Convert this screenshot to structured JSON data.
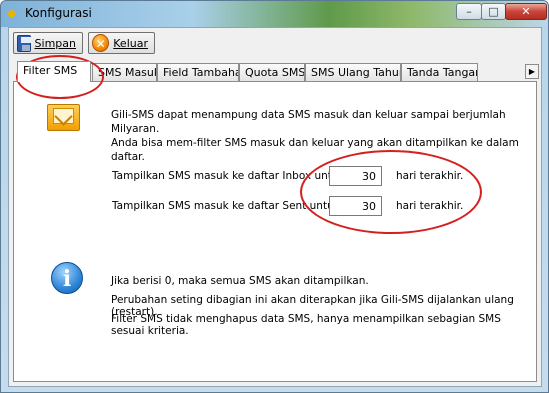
{
  "window": {
    "title": "Konfigurasi",
    "min_glyph": "–",
    "max_glyph": "□",
    "close_glyph": "✕"
  },
  "toolbar": {
    "save_label": "Simpan",
    "exit_label": "Keluar"
  },
  "tabs": [
    {
      "label": "Filter SMS",
      "active": true
    },
    {
      "label": "SMS Masuk"
    },
    {
      "label": "Field Tambahan"
    },
    {
      "label": "Quota SMS"
    },
    {
      "label": "SMS Ulang Tahun"
    },
    {
      "label": "Tanda Tangan"
    }
  ],
  "tab_scroll_glyph": "▶",
  "panel": {
    "intro_1": "Gili-SMS dapat menampung data SMS masuk dan keluar sampai berjumlah Milyaran.",
    "intro_2": "Anda bisa mem-filter SMS masuk dan keluar yang akan ditampilkan ke dalam daftar.",
    "inbox_label": "Tampilkan SMS masuk ke daftar Inbox untuk",
    "inbox_value": "30",
    "sent_label": "Tampilkan SMS masuk ke daftar Sent untuk",
    "sent_value": "30",
    "suffix": "hari terakhir.",
    "info_1": "Jika berisi 0, maka semua SMS akan ditampilkan.",
    "info_2": "Perubahan seting dibagian ini akan diterapkan jika Gili-SMS dijalankan ulang (restart).",
    "info_3": "Filter SMS tidak menghapus data SMS, hanya menampilkan sebagian SMS sesuai kriteria.",
    "info_glyph": "i"
  },
  "colors": {
    "annotation": "#d32020",
    "accent": "#2f86d6"
  }
}
